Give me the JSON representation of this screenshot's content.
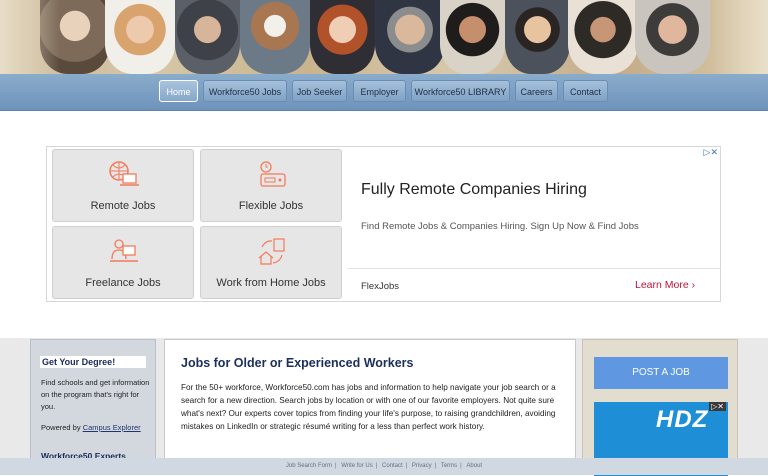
{
  "nav": {
    "items": [
      {
        "label": "Home",
        "active": true
      },
      {
        "label": "Workforce50 Jobs"
      },
      {
        "label": "Job Seeker"
      },
      {
        "label": "Employer"
      },
      {
        "label": "Workforce50 LIBRARY"
      },
      {
        "label": "Careers"
      },
      {
        "label": "Contact"
      }
    ]
  },
  "ad": {
    "tiles": [
      {
        "label": "Remote Jobs",
        "icon": "globe-laptop-icon"
      },
      {
        "label": "Flexible Jobs",
        "icon": "clock-panel-icon"
      },
      {
        "label": "Freelance Jobs",
        "icon": "person-desk-icon"
      },
      {
        "label": "Work from Home Jobs",
        "icon": "house-cycle-icon"
      }
    ],
    "headline": "Fully Remote Companies Hiring",
    "description": "Find Remote Jobs & Companies Hiring. Sign Up Now & Find Jobs",
    "source": "FlexJobs",
    "learn_more": "Learn More",
    "accent": "#f47a5a"
  },
  "left": {
    "title": "Get Your Degree!",
    "text": "Find schools and get information on the program that's right for you.",
    "powered_prefix": "Powered by",
    "powered_link": "Campus Explorer",
    "experts": "Workforce50 Experts"
  },
  "main": {
    "title": "Jobs for Older or Experienced Workers",
    "text": "For the 50+ workforce, Workforce50.com has jobs and information to help navigate your job search or a search for a new direction. Search jobs by location or with one of our favorite employers. Not quite sure what's next? Our experts cover topics from finding your life's purpose, to raising grandchildren, avoiding mistakes on LinkedIn or strategic résumé writing for a less than perfect work history."
  },
  "right": {
    "post_job": "POST A JOB",
    "ad_text": "HDZ"
  },
  "footer": {
    "links": [
      "Job Search Form",
      "Write for Us",
      "Contact",
      "Privacy",
      "Terms",
      "About"
    ]
  }
}
